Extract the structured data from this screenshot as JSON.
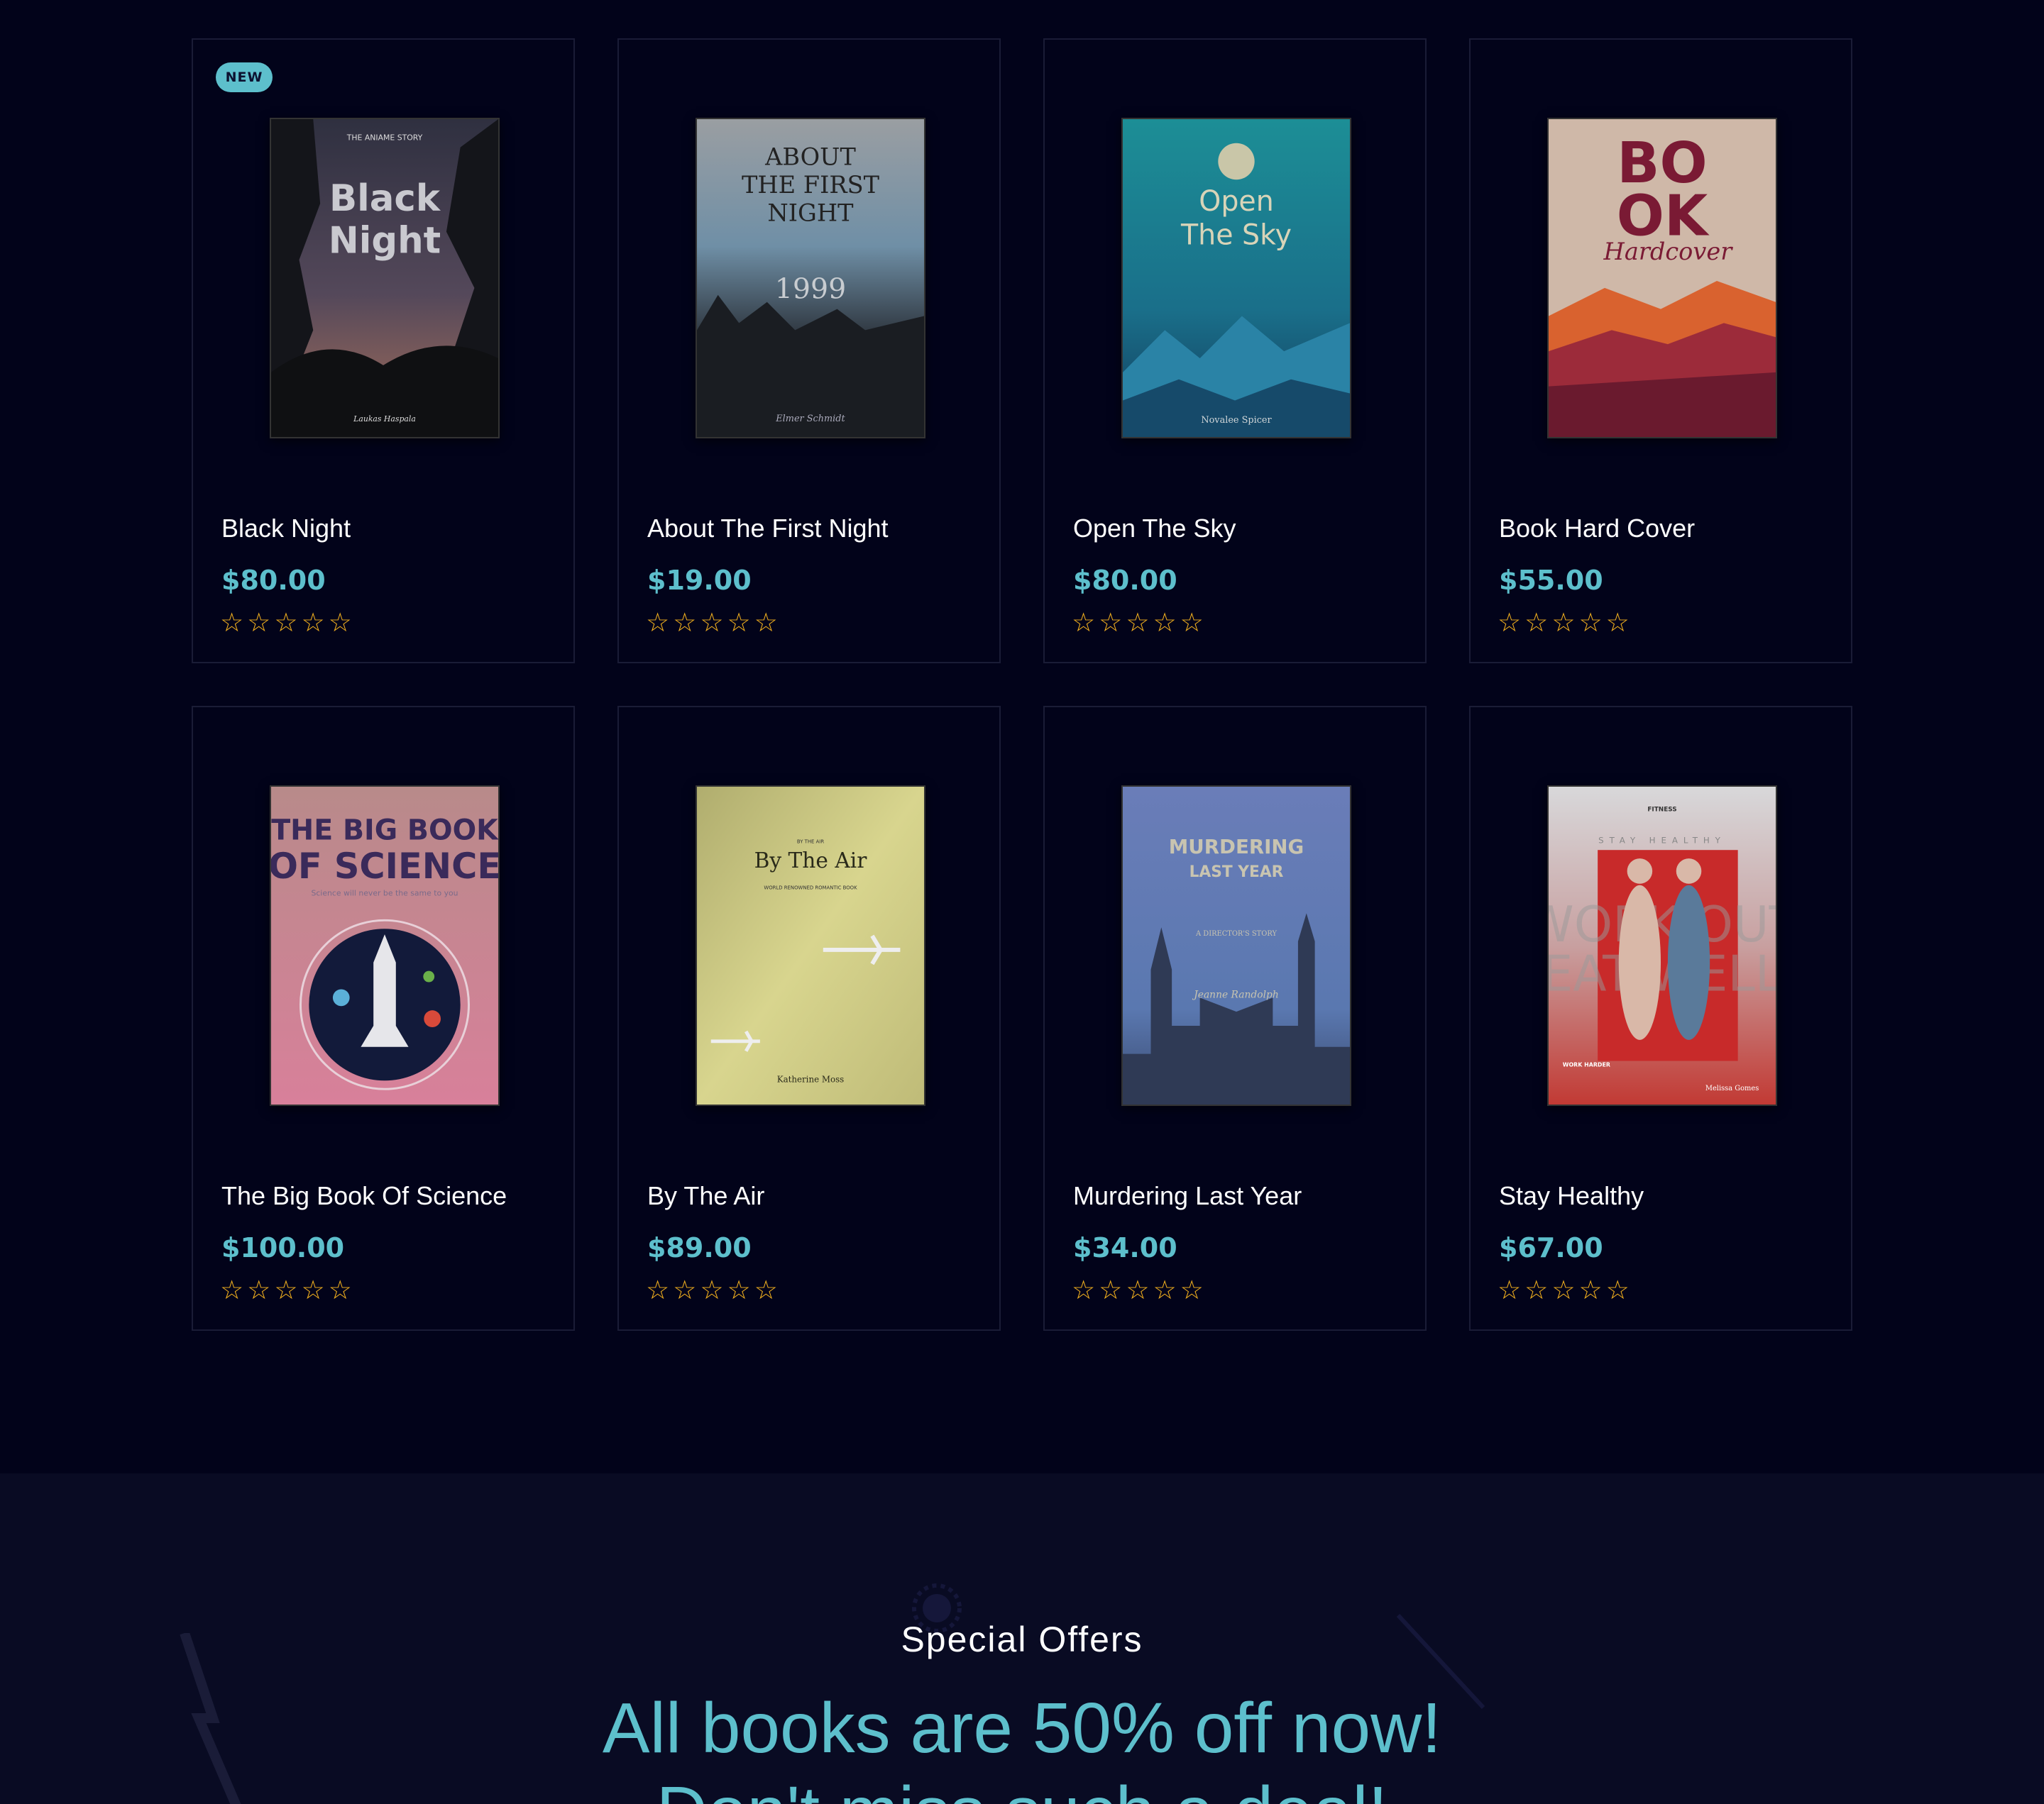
{
  "products": [
    {
      "badge": "NEW",
      "title": "Black Night",
      "price": "$80.00",
      "stars": "☆☆☆☆☆",
      "rating": 0,
      "cover": {
        "top": "THE ANIAME STORY",
        "main": "Black",
        "main2": "Night",
        "author": "Laukas Haspala"
      }
    },
    {
      "badge": "",
      "title": "About The First Night",
      "price": "$19.00",
      "stars": "☆☆☆☆☆",
      "rating": 0,
      "cover": {
        "top": "ABOUT",
        "main": "THE FIRST",
        "main2": "NIGHT",
        "year": "1999",
        "author": "Elmer Schmidt"
      }
    },
    {
      "badge": "",
      "title": "Open The Sky",
      "price": "$80.00",
      "stars": "☆☆☆☆☆",
      "rating": 0,
      "cover": {
        "main": "Open",
        "main2": "The Sky",
        "author": "Novalee Spicer"
      }
    },
    {
      "badge": "",
      "title": "Book Hard Cover",
      "price": "$55.00",
      "stars": "☆☆☆☆☆",
      "rating": 0,
      "cover": {
        "main": "BO",
        "main2": "OK",
        "script": "Hardcover"
      }
    },
    {
      "badge": "",
      "title": "The Big Book Of Science",
      "price": "$100.00",
      "stars": "☆☆☆☆☆",
      "rating": 0,
      "cover": {
        "main": "THE BIG BOOK",
        "main2": "OF SCIENCE",
        "sub": "Science will never be the same to you"
      }
    },
    {
      "badge": "",
      "title": "By The Air",
      "price": "$89.00",
      "stars": "☆☆☆☆☆",
      "rating": 0,
      "cover": {
        "top": "BY THE AIR",
        "main": "By The Air",
        "sub": "WORLD RENOWNED ROMANTIC BOOK",
        "author": "Katherine Moss"
      }
    },
    {
      "badge": "",
      "title": "Murdering Last Year",
      "price": "$34.00",
      "stars": "☆☆☆☆☆",
      "rating": 0,
      "cover": {
        "main": "MURDERING",
        "main2": "LAST YEAR",
        "sub": "A DIRECTOR'S STORY",
        "author": "Jeanne Randolph"
      }
    },
    {
      "badge": "",
      "title": "Stay Healthy",
      "price": "$67.00",
      "stars": "☆☆☆☆☆",
      "rating": 0,
      "cover": {
        "top": "FITNESS",
        "main": "STAY HEALTHY",
        "bg": "WORK OUT",
        "bg2": "EAT WELL",
        "author": "Melissa Gomes",
        "tag": "WORK HARDER"
      }
    }
  ],
  "offers": {
    "kicker": "Special Offers",
    "heading_line1": "All books are 50% off now!",
    "heading_line2": "Don't miss such a deal!"
  },
  "colors": {
    "page_bg": "#02031a",
    "accent": "#5dbfcc",
    "star": "#f2b01e",
    "card_border": "#1a1c36"
  }
}
